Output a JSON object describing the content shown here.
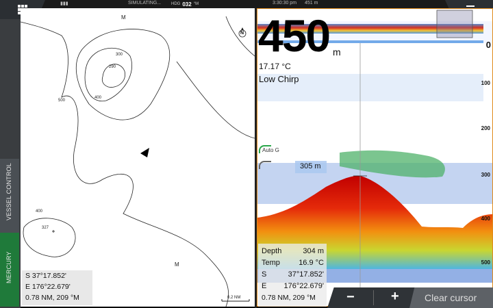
{
  "topbar": {
    "status_text": "SIMULATING...",
    "heading_label": "HDG",
    "heading_value": "032",
    "heading_unit": "°M",
    "time": "3:30:30 pm",
    "depth_small": "451 m"
  },
  "sidebar": {
    "vessel_control_label": "VESSEL CONTROL",
    "mercury_label": "MERCURY"
  },
  "chart": {
    "north_label": "N",
    "contour_labels": [
      "M",
      "300",
      "290",
      "500",
      "400",
      "400",
      "327",
      "M"
    ],
    "scale_label": "0.2 NM",
    "cursor_info": {
      "lat": "S 37°17.852'",
      "lon": "E 176°22.679'",
      "range_bearing": "0.78 NM, 209 °M"
    }
  },
  "sonar": {
    "depth_big": "450",
    "depth_unit": "m",
    "water_temp": "17.17 °C",
    "mode": "Low Chirp",
    "gain_label": "Auto G",
    "cursor_depth_label": "305 m",
    "scale": [
      "0",
      "100",
      "200",
      "300",
      "400",
      "500"
    ],
    "info": {
      "depth_key": "Depth",
      "depth_val": "304 m",
      "temp_key": "Temp",
      "temp_val": "16.9 °C",
      "lat_key": "S",
      "lat_val": "37°17.852'",
      "lon_key": "E",
      "lon_val": "176°22.679'",
      "range_bearing": "0.78 NM, 209 °M"
    }
  },
  "controls": {
    "zoom_out": "−",
    "zoom_in": "+",
    "clear_cursor": "Clear cursor"
  },
  "colors": {
    "accent_orange": "#e08a1a",
    "mercury_green": "#1f7a3a",
    "sidebar_gray": "#3a3d40"
  }
}
